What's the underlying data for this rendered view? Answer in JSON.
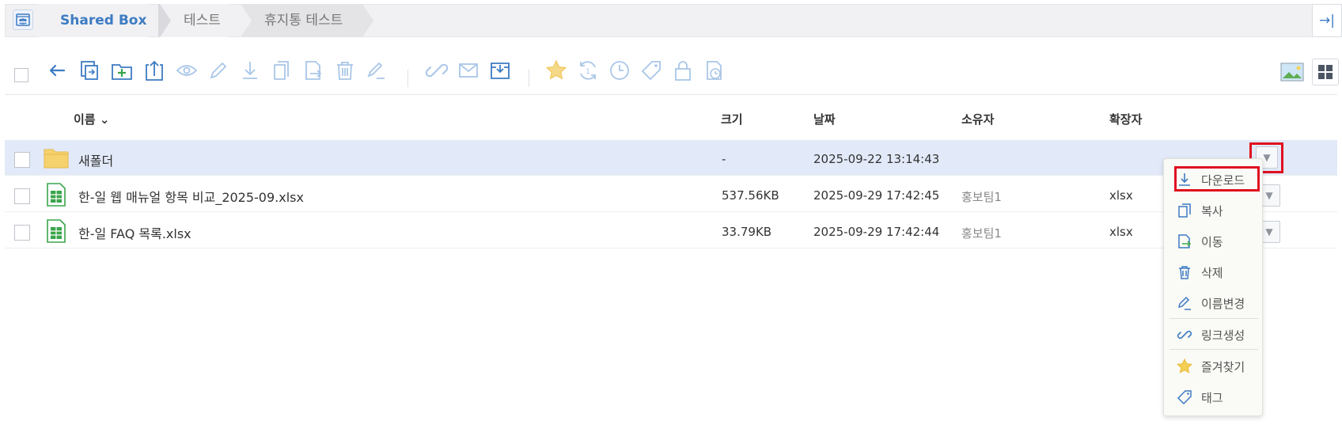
{
  "breadcrumb": {
    "root": "Shared Box",
    "items": [
      "테스트",
      "휴지통 테스트"
    ]
  },
  "collapse_glyph": "→|",
  "toolbar": {
    "icons": [
      "back-arrow-icon",
      "copy-to-icon",
      "new-folder-icon",
      "upload-icon",
      "preview-icon",
      "edit-icon",
      "download-icon",
      "copy-icon",
      "move-icon",
      "delete-icon",
      "rename-icon",
      "link-icon",
      "mail-icon",
      "archive-icon",
      "favorite-icon",
      "version-icon",
      "history-icon",
      "tag-icon",
      "lock-icon",
      "lock-time-icon"
    ]
  },
  "columns": {
    "name": "이름",
    "sort_glyph": "⌄",
    "size": "크기",
    "date": "날짜",
    "owner": "소유자",
    "ext": "확장자"
  },
  "rows": [
    {
      "name": "새폴더",
      "size": "-",
      "date": "2025-09-22 13:14:43",
      "owner": "",
      "ext": "",
      "type": "folder"
    },
    {
      "name": "한-일 웹 매뉴얼 항목 비교_2025-09.xlsx",
      "size": "537.56KB",
      "date": "2025-09-29 17:42:45",
      "owner": "홍보팀1",
      "ext": "xlsx",
      "type": "xlsx"
    },
    {
      "name": "한-일 FAQ 목록.xlsx",
      "size": "33.79KB",
      "date": "2025-09-29 17:42:44",
      "owner": "홍보팀1",
      "ext": "xlsx",
      "type": "xlsx"
    }
  ],
  "row_button_glyph": "▼",
  "context_menu": {
    "items": [
      {
        "label": "다운로드",
        "icon": "download-icon"
      },
      {
        "label": "복사",
        "icon": "copy-icon"
      },
      {
        "label": "이동",
        "icon": "move-icon"
      },
      {
        "label": "삭제",
        "icon": "delete-icon"
      },
      {
        "label": "이름변경",
        "icon": "rename-icon"
      },
      {
        "label": "링크생성",
        "icon": "link-icon"
      },
      {
        "label": "즐겨찾기",
        "icon": "favorite-icon"
      },
      {
        "label": "태그",
        "icon": "tag-icon"
      }
    ]
  },
  "colors": {
    "accent": "#3d7bc3",
    "icon_light": "#a9c6e8",
    "selected_row": "#e2e9f8",
    "highlight": "#e0101f",
    "xlsx_green": "#3aa54a",
    "folder_yellow": "#f6d26e"
  }
}
